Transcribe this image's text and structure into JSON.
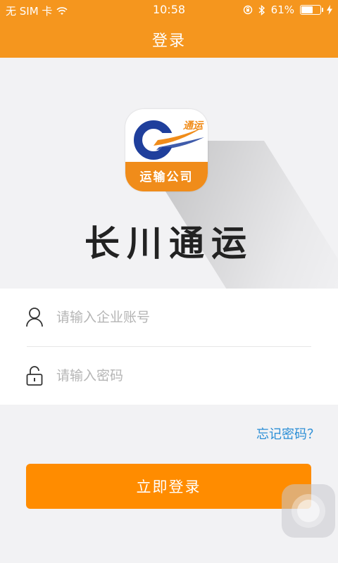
{
  "status_bar": {
    "carrier": "无 SIM 卡",
    "time": "10:58",
    "battery_percent": "61%",
    "battery_level": 0.61,
    "icons": [
      "wifi-icon",
      "orientation-lock-icon",
      "bluetooth-icon",
      "battery-icon",
      "charging-icon"
    ]
  },
  "nav": {
    "title": "登录"
  },
  "logo": {
    "app_icon_badge": "通运",
    "app_icon_label": "运输公司",
    "brand_name": "长川通运"
  },
  "form": {
    "account": {
      "placeholder": "请输入企业账号",
      "value": "",
      "icon": "user-icon"
    },
    "password": {
      "placeholder": "请输入密码",
      "value": "",
      "icon": "lock-icon"
    }
  },
  "forgot_password_label": "忘记密码？",
  "login_button_label": "立即登录",
  "colors": {
    "primary": "#f5961e",
    "button": "#ff8c00",
    "link": "#2c8fd6",
    "logo_blue": "#1f3f9c"
  }
}
